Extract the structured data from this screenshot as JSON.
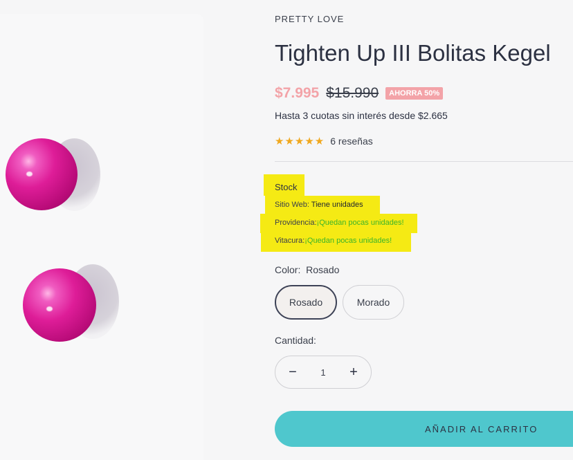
{
  "product": {
    "brand": "PRETTY LOVE",
    "title": "Tighten Up III Bolitas Kegel",
    "price_sale": "$7.995",
    "price_original": "$15.990",
    "discount_badge": "AHORRA 50%",
    "installments": "Hasta 3 cuotas sin interés desde $2.665",
    "rating_stars": "★★★★★",
    "reviews": "6 reseñas"
  },
  "stock": {
    "title": "Stock",
    "locations": [
      {
        "label": "Sitio Web:",
        "status": "Tiene unidades"
      },
      {
        "label": "Providencia:",
        "status": "¡Quedan pocas unidades!"
      },
      {
        "label": "Vitacura:",
        "status": "¡Quedan pocas unidades!"
      }
    ]
  },
  "color": {
    "label": "Color:",
    "selected": "Rosado",
    "options": [
      "Rosado",
      "Morado"
    ]
  },
  "quantity": {
    "label": "Cantidad:",
    "minus": "−",
    "value": "1",
    "plus": "+"
  },
  "cart": {
    "add_label": "AÑADIR AL CARRITO"
  },
  "colors": {
    "sale_price": "#f3a3a8",
    "highlight": "#f5ea14",
    "stock_low": "#3bb52a",
    "add_button": "#4fc7cd",
    "stars": "#f0a81e"
  }
}
